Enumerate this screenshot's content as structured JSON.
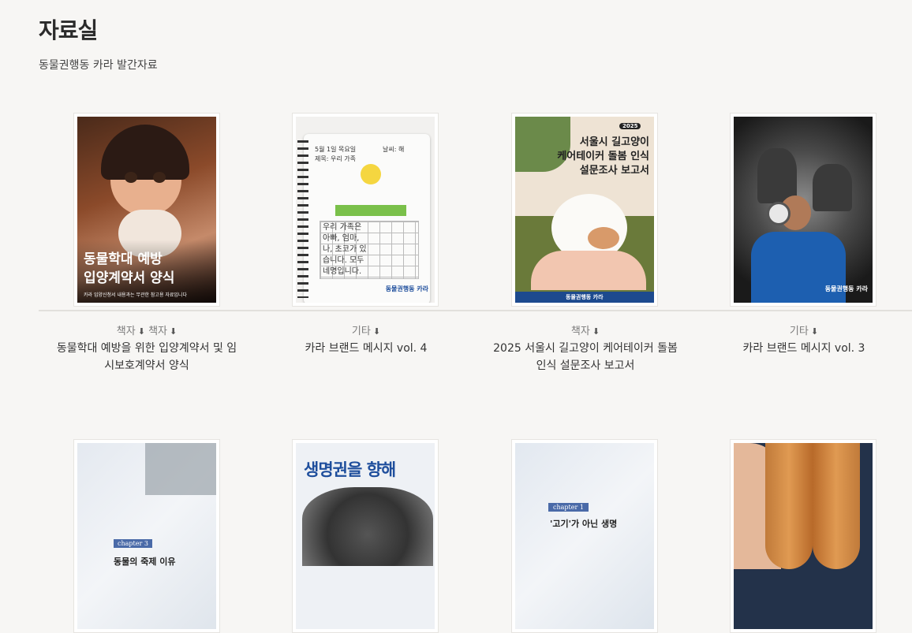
{
  "page": {
    "title": "자료실",
    "subtitle": "동물권행동 카라 발간자료"
  },
  "items": [
    {
      "categories": [
        "책자",
        "책자"
      ],
      "title": "동물학대 예방을 위한 입양계약서 및 임시보호계약서 양식",
      "cover_text": {
        "headline1": "동물학대 예방",
        "headline2": "입양계약서 양식",
        "footnote": "카라 입양신청서 내용과는 무관한 참고용 자료입니다"
      }
    },
    {
      "categories": [
        "기타"
      ],
      "title": "카라 브랜드 메시지 vol. 4",
      "cover_text": {
        "diary_date": "5월 1일 목요일",
        "diary_weather": "날씨: 해",
        "diary_subject": "제목: 우리 가족",
        "grid_lines": [
          "우리 가족은",
          "아빠, 엄마,",
          "나, 초코가 있",
          "습니다. 모두",
          "네명입니다."
        ],
        "brand": "동물권행동 카라"
      }
    },
    {
      "categories": [
        "책자"
      ],
      "title": "2025 서울시 길고양이 케어테이커 돌봄 인식 설문조사 보고서",
      "cover_text": {
        "year": "2025",
        "line1": "서울시 길고양이",
        "line2": "케어테이커 돌봄 인식",
        "line3": "설문조사 보고서",
        "brand": "동물권행동 카라"
      }
    },
    {
      "categories": [
        "기타"
      ],
      "title": "카라 브랜드 메시지 vol. 3",
      "cover_text": {
        "brand": "동물권행동 카라"
      }
    },
    {
      "cover_text": {
        "chapter": "chapter 3",
        "caption": "동물의 죽제 이유"
      }
    },
    {
      "cover_text": {
        "headline": "생명권을 향해"
      }
    },
    {
      "cover_text": {
        "chapter": "chapter 1",
        "caption": "'고기'가 아닌 생명"
      }
    },
    {
      "cover_text": {}
    }
  ],
  "icons": {
    "download": "download-icon"
  },
  "colors": {
    "background": "#f7f6f4",
    "accent_blue": "#1e4e9c"
  }
}
